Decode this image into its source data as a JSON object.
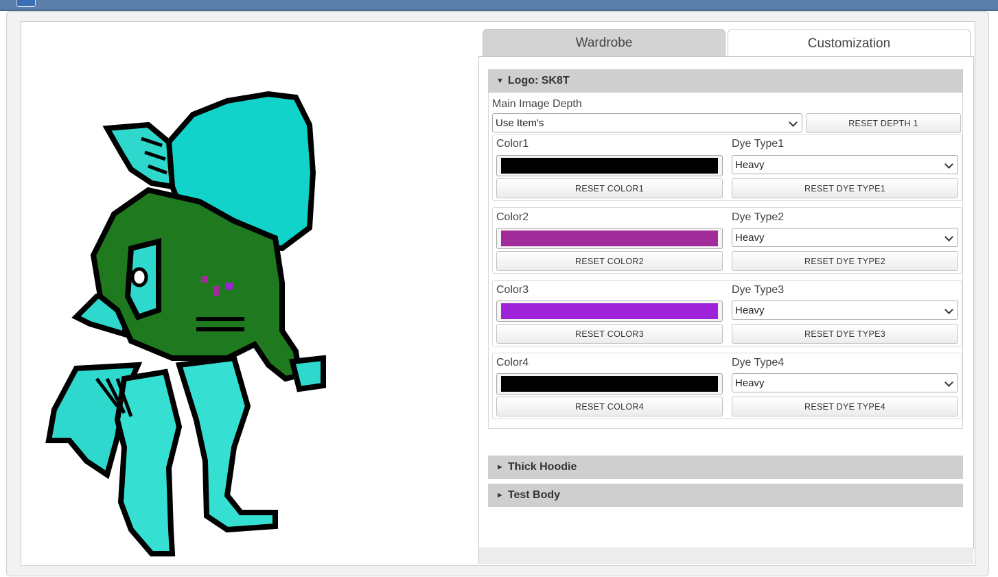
{
  "tabs": [
    {
      "label": "Wardrobe",
      "active": false
    },
    {
      "label": "Customization",
      "active": true
    }
  ],
  "sections": {
    "logo": {
      "title": "Logo: SK8T",
      "expanded": true,
      "depth_label": "Main Image Depth",
      "depth_value": "Use Item's",
      "reset_depth": "RESET DEPTH 1",
      "colors": [
        {
          "color_label": "Color1",
          "dye_label": "Dye Type1",
          "dye_value": "Heavy",
          "swatch": "#000000",
          "reset_color": "RESET COLOR1",
          "reset_dye": "RESET DYE TYPE1"
        },
        {
          "color_label": "Color2",
          "dye_label": "Dye Type2",
          "dye_value": "Heavy",
          "swatch": "#a12b99",
          "reset_color": "RESET COLOR2",
          "reset_dye": "RESET DYE TYPE2"
        },
        {
          "color_label": "Color3",
          "dye_label": "Dye Type3",
          "dye_value": "Heavy",
          "swatch": "#9f22d9",
          "reset_color": "RESET COLOR3",
          "reset_dye": "RESET DYE TYPE3"
        },
        {
          "color_label": "Color4",
          "dye_label": "Dye Type4",
          "dye_value": "Heavy",
          "swatch": "#000000",
          "reset_color": "RESET COLOR4",
          "reset_dye": "RESET DYE TYPE4"
        }
      ]
    },
    "hoodie": {
      "title": "Thick Hoodie",
      "expanded": false
    },
    "body": {
      "title": "Test Body",
      "expanded": false
    }
  },
  "icons": {
    "expanded_arrow": "▼",
    "collapsed_arrow": "►"
  },
  "colors": {
    "header_bar": "#5b7fa8",
    "character_cyan": "#1fd6cc",
    "hoodie_green": "#1f7a1f"
  }
}
